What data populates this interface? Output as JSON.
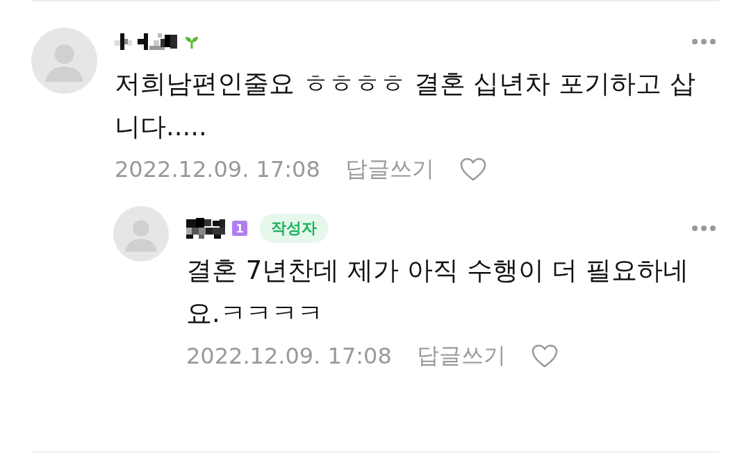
{
  "comments": [
    {
      "kind": "comment",
      "badge": {
        "kind": "sprout"
      },
      "text": "저희남편인줄요 ㅎㅎㅎㅎ 결혼 십년차 포기하고 삽니다.....",
      "date": "2022.12.09. 17:08",
      "reply_link": "답글쓰기",
      "liked": false
    },
    {
      "kind": "reply",
      "badge": {
        "kind": "level",
        "label": "1"
      },
      "author_tag": "작성자",
      "text": "결혼 7년찬데 제가 아직 수행이 더 필요하네요.ㅋㅋㅋㅋ",
      "date": "2022.12.09. 17:08",
      "reply_link": "답글쓰기",
      "liked": false
    }
  ]
}
